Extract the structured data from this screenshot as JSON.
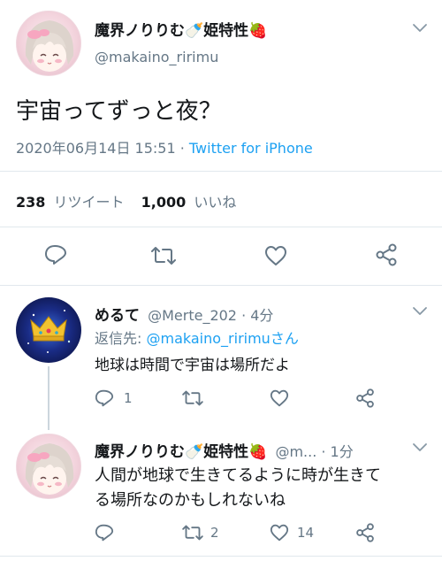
{
  "main_tweet": {
    "display_name": "魔界ノりりむ🍼姫特性🍓",
    "handle": "@makaino_ririmu",
    "text": "宇宙ってずっと夜？",
    "date": "2020年06月14日 15:51",
    "separator": " · ",
    "source": "Twitter for iPhone",
    "retweet_count": "238",
    "retweet_label": "リツイート",
    "like_count": "1,000",
    "like_label": "いいね"
  },
  "replies": [
    {
      "display_name": "めるて",
      "handle_time": "@Merte_202 · 4分",
      "reply_to_prefix": "返信先: ",
      "reply_to_handle": "@makaino_ririmuさん",
      "text": "地球は時間で宇宙は場所だよ",
      "reply_count": "1",
      "retweet_count": "",
      "like_count": ""
    },
    {
      "display_name": "魔界ノりりむ🍼姫特性🍓",
      "handle_time": "@m... · 1分",
      "text_line1": "人間が地球で生きてるように時が生きて",
      "text_line2": "る場所なのかもしれないね",
      "reply_count": "",
      "retweet_count": "2",
      "like_count": "14"
    }
  ],
  "colors": {
    "accent": "#1da1f2",
    "muted": "#657786",
    "text": "#14171a",
    "divider": "#e1e8ed"
  },
  "icons": [
    "chevron-down-icon",
    "reply-icon",
    "retweet-icon",
    "like-icon",
    "share-icon",
    "crown-icon"
  ]
}
